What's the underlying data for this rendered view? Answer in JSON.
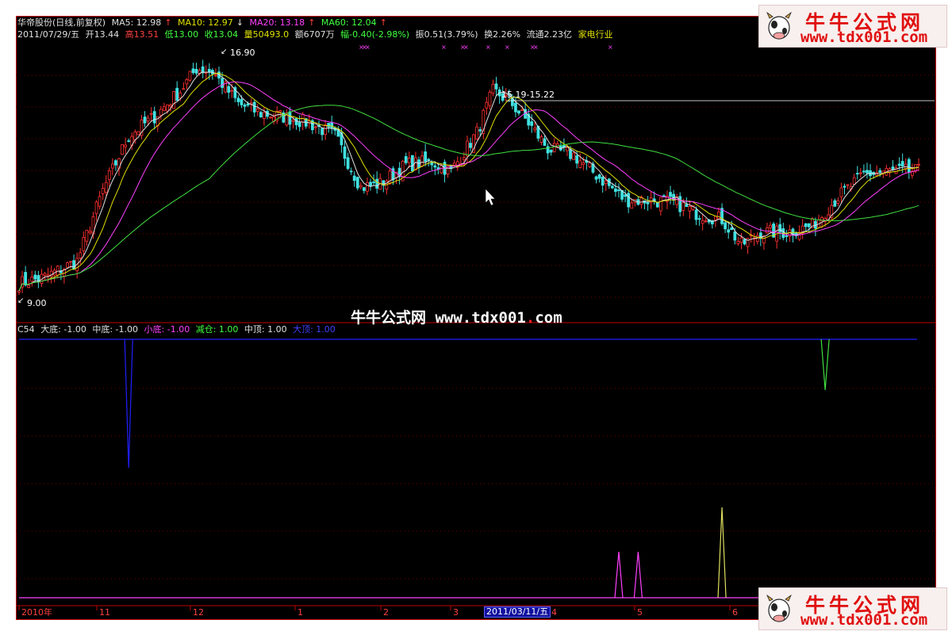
{
  "header": {
    "title": "华帝股份(日线,前复权)",
    "ma5": "MA5: 12.98",
    "ma10": "MA10: 12.97",
    "ma20": "MA20: 13.18",
    "ma60": "MA60: 12.04",
    "date": "2011/07/29/五",
    "open": "开13.44",
    "high": "高13.51",
    "low": "低13.00",
    "close": "收13.04",
    "volume": "量50493.0",
    "amount": "额6707万",
    "change": "幅-0.40(-2.98%)",
    "amplitude": "振0.51(3.79%)",
    "turnover": "换2.26%",
    "float": "流通2.23亿",
    "industry": "家电行业"
  },
  "indicator": {
    "name": "C54",
    "dadi": "大底: -1.00",
    "zhongdi": "中底: -1.00",
    "xiaodi": "小底: -1.00",
    "jiancang": "减仓: 1.00",
    "zhongding": "中顶: 1.00",
    "dading": "大顶: 1.00"
  },
  "annotations": {
    "high_label": "16.90",
    "low_label": "9.00",
    "range_label": "15.19-15.22"
  },
  "watermark": {
    "brand": "牛牛公式网",
    "url_main": "www.tdx001",
    "url_dot": ".",
    "url_tail": "com"
  },
  "logo": {
    "title": "牛牛公式网",
    "url": "www.tdx001.com"
  },
  "xaxis": {
    "labels": [
      "2010年",
      "11",
      "12",
      "1",
      "2",
      "3",
      "4",
      "5",
      "6"
    ],
    "cursor_date": "2011/03/11/五"
  },
  "colors": {
    "up": "#ff3030",
    "down": "#40e0e0",
    "ma5": "#e0e0e0",
    "ma10": "#e0e000",
    "ma20": "#ff40ff",
    "ma60": "#40e040",
    "frame": "#c00000"
  },
  "chart_data": [
    {
      "type": "candlestick",
      "title": "华帝股份(日线,前复权)",
      "ylim": [
        9.0,
        16.9
      ],
      "x_labels": [
        "2010年",
        "11",
        "12",
        "1",
        "2",
        "3",
        "4",
        "5",
        "6"
      ],
      "close_path": [
        [
          0,
          9.6
        ],
        [
          8,
          9.8
        ],
        [
          18,
          10.3
        ],
        [
          26,
          12.5
        ],
        [
          34,
          14.2
        ],
        [
          42,
          14.8
        ],
        [
          50,
          15.6
        ],
        [
          55,
          16.3
        ],
        [
          60,
          16.2
        ],
        [
          68,
          15.2
        ],
        [
          75,
          14.9
        ],
        [
          82,
          14.8
        ],
        [
          90,
          14.6
        ],
        [
          98,
          14.2
        ],
        [
          106,
          12.6
        ],
        [
          112,
          12.7
        ],
        [
          120,
          13.3
        ],
        [
          128,
          13.4
        ],
        [
          134,
          13.1
        ],
        [
          142,
          14.3
        ],
        [
          147,
          15.6
        ],
        [
          152,
          15.3
        ],
        [
          158,
          14.6
        ],
        [
          164,
          13.8
        ],
        [
          172,
          13.6
        ],
        [
          180,
          12.9
        ],
        [
          188,
          12.2
        ],
        [
          196,
          12.2
        ],
        [
          204,
          12.1
        ],
        [
          210,
          11.8
        ],
        [
          218,
          11.6
        ],
        [
          224,
          10.8
        ],
        [
          230,
          11.2
        ],
        [
          238,
          11.2
        ],
        [
          246,
          11.4
        ],
        [
          254,
          12.3
        ],
        [
          262,
          13.0
        ],
        [
          270,
          13.1
        ],
        [
          276,
          13.1
        ]
      ],
      "ma_levels": {
        "MA5": 12.98,
        "MA10": 12.97,
        "MA20": 13.18,
        "MA60": 12.04
      }
    },
    {
      "type": "line",
      "title": "C54",
      "ylim": [
        -1.0,
        1.0
      ],
      "series": [
        {
          "name": "大底",
          "spikes": [
            34
          ],
          "value": -1.0
        },
        {
          "name": "中底",
          "spikes": [],
          "value": -1.0
        },
        {
          "name": "小底",
          "spikes": [],
          "value": -1.0
        },
        {
          "name": "减仓",
          "spikes": [
            250
          ],
          "value": 1.0
        },
        {
          "name": "中顶",
          "spikes": [
            218
          ],
          "value": 1.0
        },
        {
          "name": "大顶",
          "spikes": [
            186,
            192
          ],
          "value": 1.0
        }
      ]
    }
  ]
}
